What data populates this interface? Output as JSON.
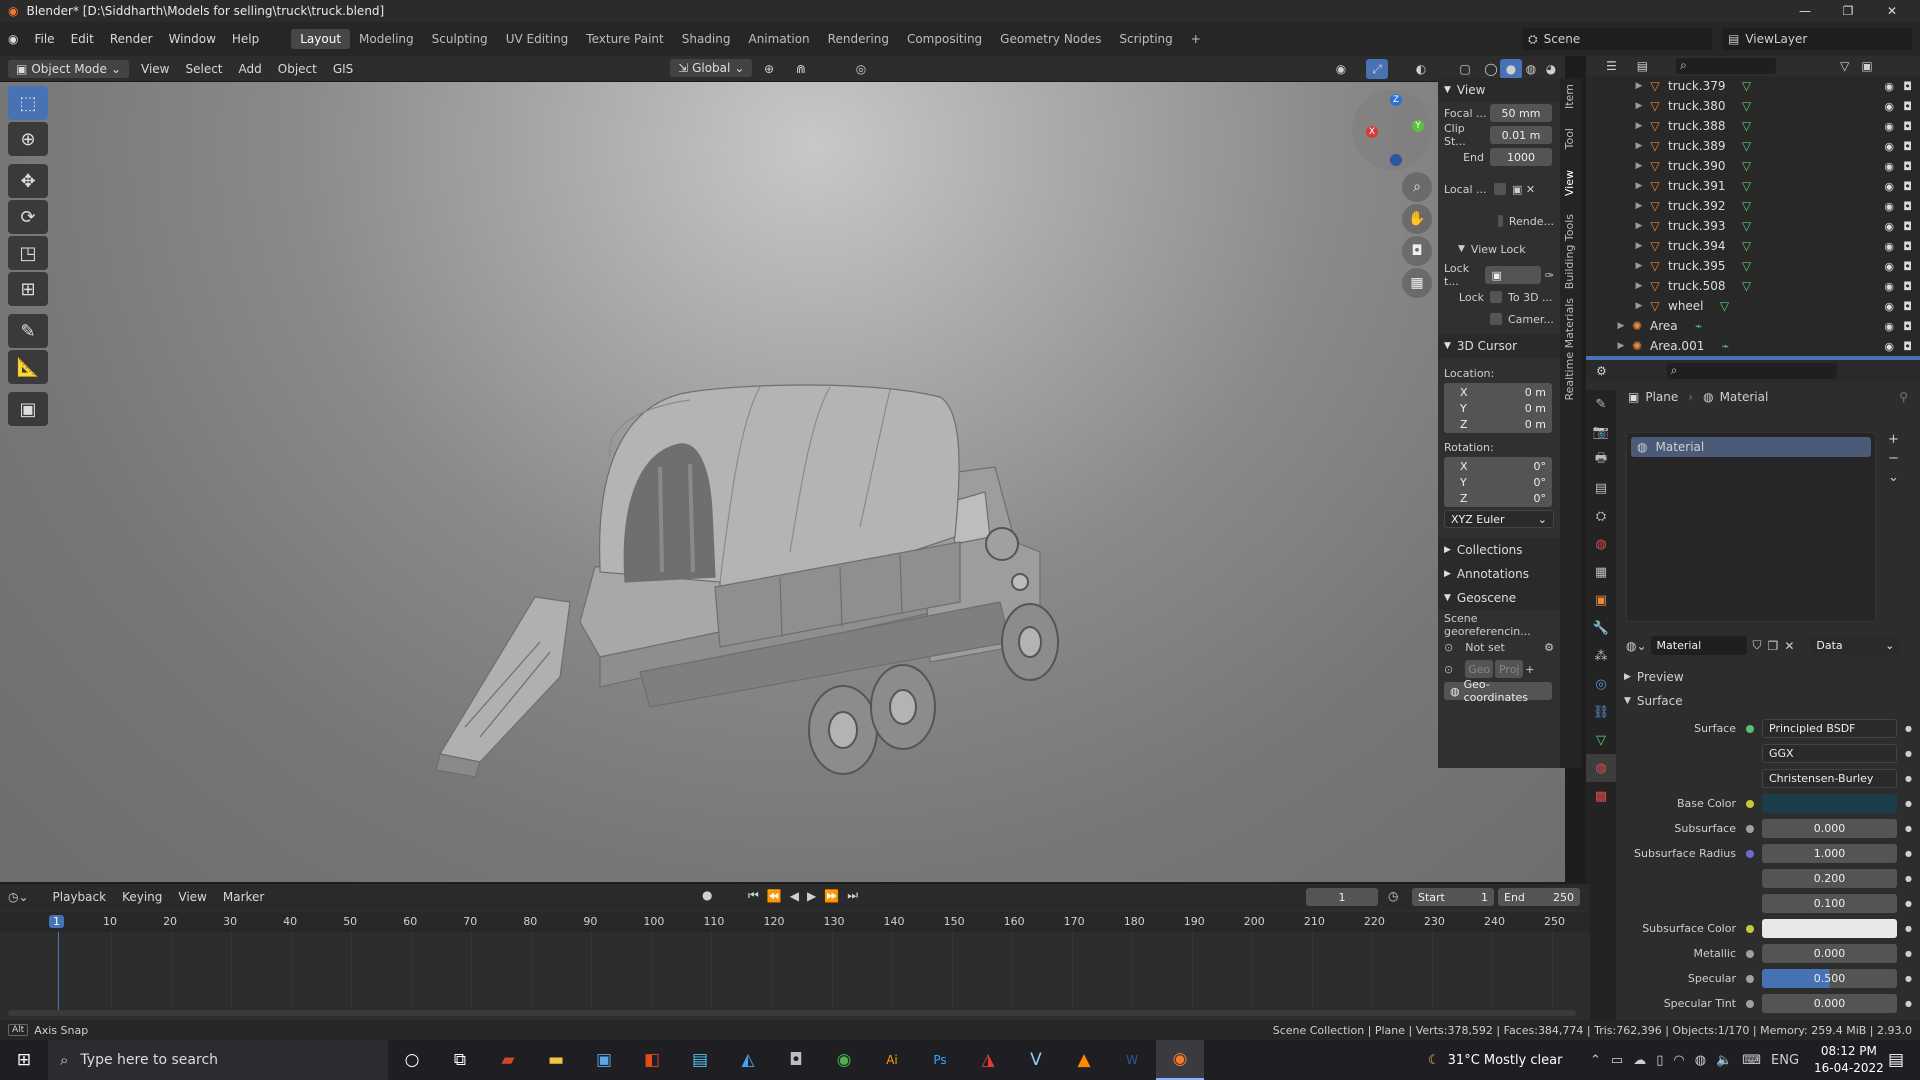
{
  "window": {
    "title": "Blender* [D:\\Siddharth\\Models for selling\\truck\\truck.blend]"
  },
  "menu": [
    "File",
    "Edit",
    "Render",
    "Window",
    "Help"
  ],
  "workspaces": [
    "Layout",
    "Modeling",
    "Sculpting",
    "UV Editing",
    "Texture Paint",
    "Shading",
    "Animation",
    "Rendering",
    "Compositing",
    "Geometry Nodes",
    "Scripting"
  ],
  "scene": {
    "name": "Scene",
    "view_layer": "ViewLayer"
  },
  "viewport_header": {
    "mode": "Object Mode",
    "menus": [
      "View",
      "Select",
      "Add",
      "Object",
      "GIS"
    ],
    "orientation": "Global"
  },
  "npanel": {
    "view": {
      "title": "View",
      "focal_label": "Focal ...",
      "focal": "50 mm",
      "clip_start_label": "Clip St...",
      "clip_start": "0.01 m",
      "end_label": "End",
      "end": "1000",
      "local_label": "Local ...",
      "render_label": "Rende..."
    },
    "view_lock": {
      "title": "View Lock",
      "lock_to_label": "Lock t...",
      "lock_label": "Lock",
      "to3d": "To 3D ...",
      "camera": "Camer..."
    },
    "cursor": {
      "title": "3D Cursor",
      "location_label": "Location:",
      "rotation_label": "Rotation:",
      "loc": [
        {
          "axis": "X",
          "val": "0 m"
        },
        {
          "axis": "Y",
          "val": "0 m"
        },
        {
          "axis": "Z",
          "val": "0 m"
        }
      ],
      "rot": [
        {
          "axis": "X",
          "val": "0°"
        },
        {
          "axis": "Y",
          "val": "0°"
        },
        {
          "axis": "Z",
          "val": "0°"
        }
      ],
      "mode": "XYZ Euler"
    },
    "collections": "Collections",
    "annotations": "Annotations",
    "geoscene": {
      "title": "Geoscene",
      "georef": "Scene georeferencin...",
      "not_set": "Not set",
      "geo": "Geo",
      "proj": "Proj",
      "geo_coords": "Geo-coordinates"
    },
    "tabs": [
      "Item",
      "Tool",
      "View",
      "Building Tools",
      "Realtime Materials"
    ]
  },
  "outliner": {
    "items": [
      {
        "name": "truck.379"
      },
      {
        "name": "truck.380"
      },
      {
        "name": "truck.388"
      },
      {
        "name": "truck.389"
      },
      {
        "name": "truck.390"
      },
      {
        "name": "truck.391"
      },
      {
        "name": "truck.392"
      },
      {
        "name": "truck.393"
      },
      {
        "name": "truck.394"
      },
      {
        "name": "truck.395"
      },
      {
        "name": "truck.508"
      },
      {
        "name": "wheel"
      }
    ],
    "lights": [
      {
        "name": "Area"
      },
      {
        "name": "Area.001"
      }
    ]
  },
  "properties": {
    "breadcrumb_object": "Plane",
    "breadcrumb_material": "Material",
    "slot": "Material",
    "material_name": "Material",
    "link": "Data",
    "preview": "Preview",
    "surface_section": "Surface",
    "rows": [
      {
        "label": "Surface",
        "value": "Principled BSDF",
        "dot": "#56c46e"
      },
      {
        "label": "",
        "value": "GGX",
        "dot": ""
      },
      {
        "label": "",
        "value": "Christensen-Burley",
        "dot": ""
      },
      {
        "label": "Base Color",
        "value": "",
        "dot": "#c8c83a"
      },
      {
        "label": "Subsurface",
        "value": "0.000",
        "dot": "#a0a0a0"
      },
      {
        "label": "Subsurface Radius",
        "value": "1.000",
        "dot": "#6b6bd1"
      },
      {
        "label": "",
        "value": "0.200",
        "dot": ""
      },
      {
        "label": "",
        "value": "0.100",
        "dot": ""
      },
      {
        "label": "Subsurface Color",
        "value": "",
        "dot": "#c8c83a"
      },
      {
        "label": "Metallic",
        "value": "0.000",
        "dot": "#a0a0a0"
      },
      {
        "label": "Specular",
        "value": "0.500",
        "dot": "#a0a0a0"
      },
      {
        "label": "Specular Tint",
        "value": "0.000",
        "dot": "#a0a0a0"
      }
    ]
  },
  "timeline": {
    "menus": [
      "Playback",
      "Keying",
      "View",
      "Marker"
    ],
    "current_frame": "1",
    "start_label": "Start",
    "start": "1",
    "end_label": "End",
    "end": "250",
    "ticks": [
      "1",
      "10",
      "20",
      "30",
      "40",
      "50",
      "60",
      "70",
      "80",
      "90",
      "100",
      "110",
      "120",
      "130",
      "140",
      "150",
      "160",
      "170",
      "180",
      "190",
      "200",
      "210",
      "220",
      "230",
      "240",
      "250"
    ]
  },
  "status": {
    "left_key": "Alt",
    "left": "Axis Snap",
    "right": "Scene Collection | Plane | Verts:378,592 | Faces:384,774 | Tris:762,396 | Objects:1/170 | Memory: 259.4 MiB | 2.93.0"
  },
  "taskbar": {
    "search": "Type here to search",
    "weather": "31°C  Mostly clear",
    "lang": "ENG",
    "time": "08:12 PM",
    "date": "16-04-2022"
  },
  "colors": {
    "accent": "#4772b3",
    "base_color_swatch": "#1d3d4a",
    "subsurface_swatch": "#e8e8e8"
  }
}
